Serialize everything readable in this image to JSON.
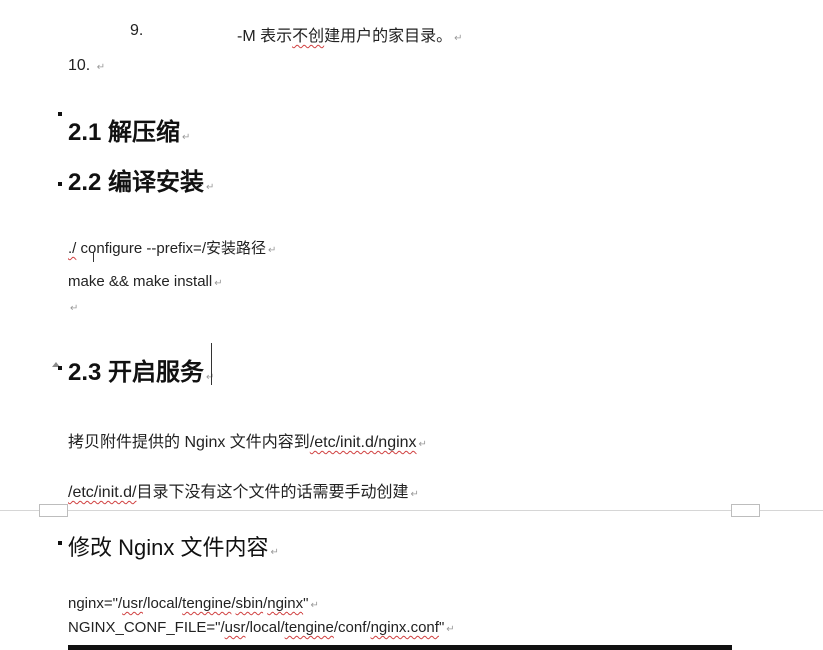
{
  "list": {
    "item9": {
      "number": "9.",
      "option": "-M",
      "text_a": "表示",
      "text_b": "不创",
      "text_c": "建用户的家目录。"
    },
    "item10": {
      "number": "10."
    }
  },
  "sections": {
    "s21": "2.1 解压缩",
    "s22": "2.2 编译安装",
    "s23": "2.3 开启服务",
    "modify": "修改 Nginx 文件内容"
  },
  "commands": {
    "configure_dot": "./",
    "configure_rest": " configure --prefix=/安装路径",
    "make": "make && make install"
  },
  "paragraphs": {
    "copy_prefix": "拷贝附件提供的 Nginx 文件内容到",
    "copy_path": "/etc/init.d/nginx",
    "dir_path": "/etc/init.d/",
    "dir_rest": "目录下没有这个文件的话需要手动创建"
  },
  "config": {
    "nginx_a": "nginx=\"/",
    "nginx_b": "usr",
    "nginx_c": "/local/",
    "nginx_d": "tengine",
    "nginx_e": "/",
    "nginx_f": "sbin",
    "nginx_g": "/",
    "nginx_h": "nginx",
    "nginx_i": "\"",
    "conf_a": "NGINX_CONF_FILE=\"/",
    "conf_b": "usr",
    "conf_c": "/local/",
    "conf_d": "tengine",
    "conf_e": "/conf/",
    "conf_f": "nginx.conf",
    "conf_g": "\""
  },
  "marks": {
    "paragraph": "↵"
  }
}
